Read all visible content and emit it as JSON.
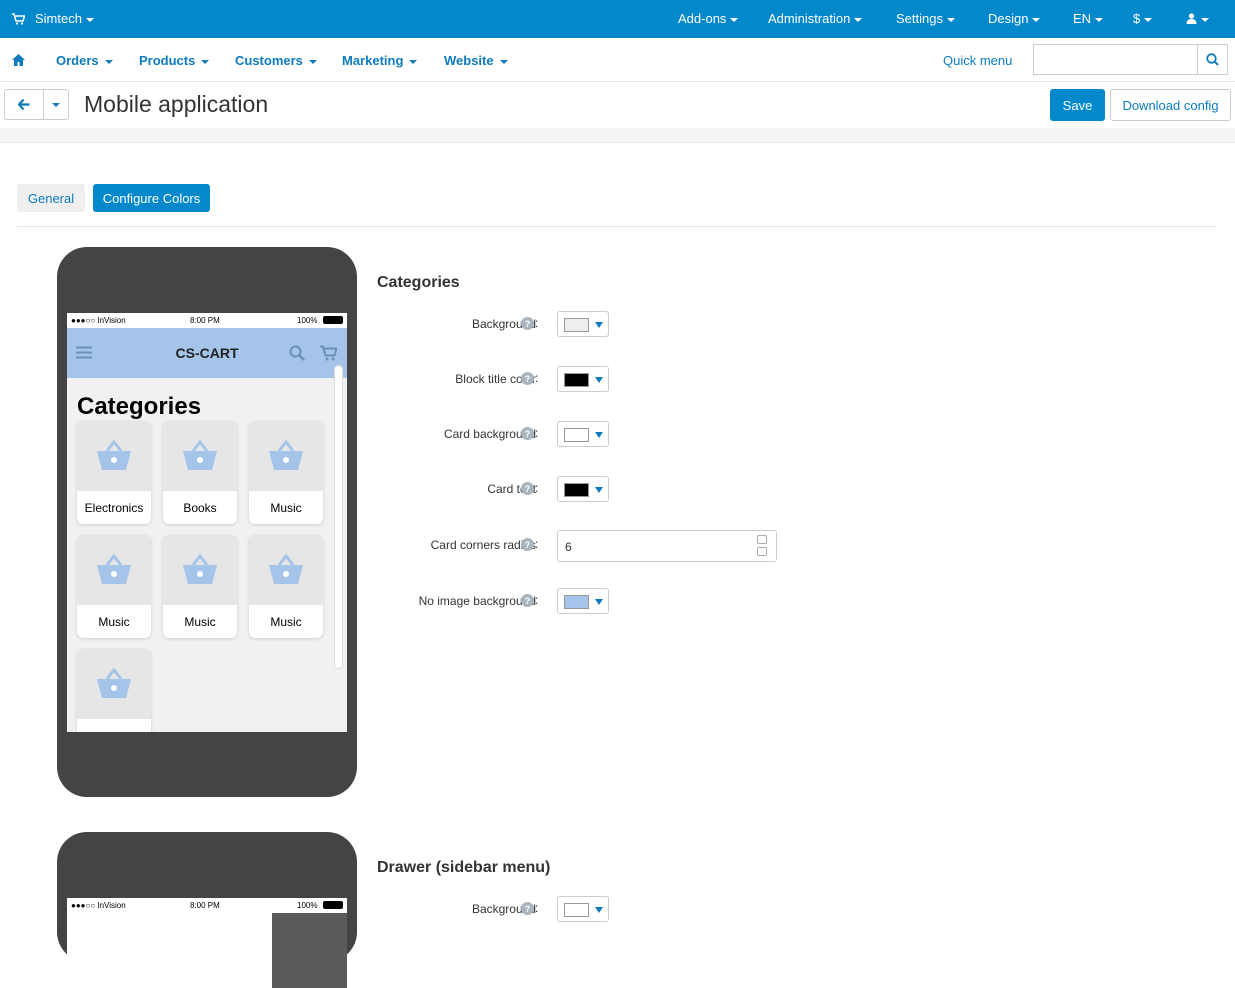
{
  "topbar": {
    "store_name": "Simtech",
    "addons": "Add-ons",
    "administration": "Administration",
    "settings": "Settings",
    "design": "Design",
    "lang": "EN",
    "currency": "$"
  },
  "mainnav": {
    "orders": "Orders",
    "products": "Products",
    "customers": "Customers",
    "marketing": "Marketing",
    "website": "Website",
    "quick_menu": "Quick menu",
    "search_value": ""
  },
  "titlebar": {
    "title": "Mobile application",
    "save": "Save",
    "download": "Download config"
  },
  "tabs": {
    "general": "General",
    "colors": "Configure Colors"
  },
  "preview": {
    "carrier": "●●●○○ InVision",
    "time": "8:00 PM",
    "battery": "100%",
    "brand": "CS-CART",
    "heading": "Categories",
    "cards": [
      "Electronics",
      "Books",
      "Music",
      "Music",
      "Music",
      "Music",
      ""
    ]
  },
  "categories": {
    "title": "Categories",
    "fields": {
      "background": {
        "label": "Background",
        "color": "#eeeeee"
      },
      "block_title": {
        "label": "Block title color",
        "color": "#000000"
      },
      "card_bg": {
        "label": "Card background",
        "color": "#ffffff"
      },
      "card_text": {
        "label": "Card text",
        "color": "#000000"
      },
      "radius": {
        "label": "Card corners radius",
        "value": "6"
      },
      "no_image": {
        "label": "No image background",
        "color": "#a4c4e9"
      }
    }
  },
  "drawer": {
    "title": "Drawer (sidebar menu)",
    "background": {
      "label": "Background",
      "color": "#ffffff"
    }
  },
  "colors": {
    "brand": "#0388cc",
    "link": "#0e7bbd",
    "preview_header": "#a4c4e9"
  }
}
